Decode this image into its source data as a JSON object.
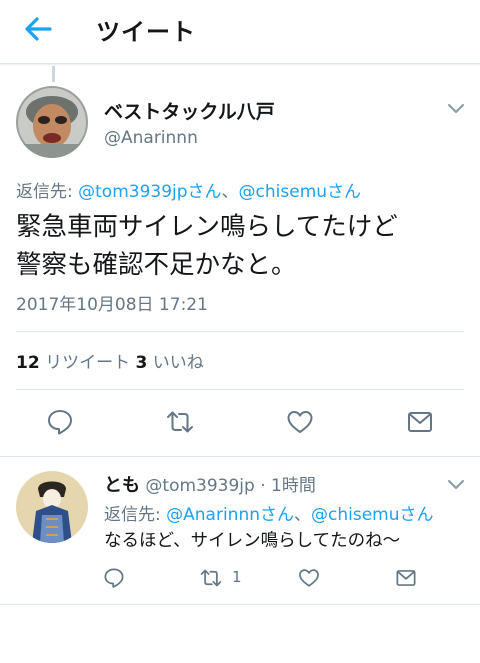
{
  "header": {
    "title": "ツイート"
  },
  "main_tweet": {
    "display_name": "ベストタックル八戸",
    "handle": "@Anarinnn",
    "replying_label": "返信先: ",
    "replying_mention_1": "@tom3939jpさん",
    "replying_separator": "、",
    "replying_mention_2": "@chisemuさん",
    "text_line_1": "緊急車両サイレン鳴らしてたけど",
    "text_line_2": "警察も確認不足かなと。",
    "timestamp": "2017年10月08日 17:21",
    "retweet_count": "12",
    "retweet_label": " リツイート ",
    "like_count": "3",
    "like_label": " いいね"
  },
  "reply_tweet": {
    "display_name": "とも",
    "handle_time": " @tom3939jp · 1時間",
    "replying_label": "返信先: ",
    "replying_mention_1": "@Anarinnnさん",
    "replying_separator": "、",
    "replying_mention_2": "@chisemuさん",
    "text": "なるほど、サイレン鳴らしてたのね〜",
    "retweet_count": "1"
  },
  "colors": {
    "accent": "#1da1f2",
    "secondary_text": "#657786",
    "divider": "#e1e8ed"
  },
  "icons": [
    "back-arrow-icon",
    "chevron-down-icon",
    "reply-icon",
    "retweet-icon",
    "like-heart-icon",
    "message-icon"
  ]
}
